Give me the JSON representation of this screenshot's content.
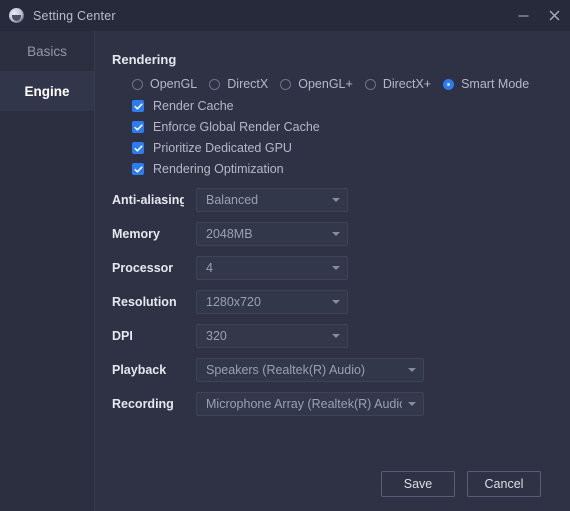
{
  "window": {
    "title": "Setting Center",
    "logo_icon": "app-logo-icon",
    "minimize_label": "–",
    "close_label": "×"
  },
  "sidebar": {
    "items": [
      {
        "label": "Basics",
        "active": false
      },
      {
        "label": "Engine",
        "active": true
      }
    ]
  },
  "main": {
    "section_title": "Rendering",
    "render_modes": [
      {
        "label": "OpenGL",
        "selected": false
      },
      {
        "label": "DirectX",
        "selected": false
      },
      {
        "label": "OpenGL+",
        "selected": false
      },
      {
        "label": "DirectX+",
        "selected": false
      },
      {
        "label": "Smart Mode",
        "selected": true
      }
    ],
    "checkboxes": [
      {
        "label": "Render Cache",
        "checked": true
      },
      {
        "label": "Enforce Global Render Cache",
        "checked": true
      },
      {
        "label": "Prioritize Dedicated GPU",
        "checked": true
      },
      {
        "label": "Rendering Optimization",
        "checked": true
      }
    ],
    "fields": [
      {
        "label": "Anti-aliasing",
        "value": "Balanced",
        "width": "narrow"
      },
      {
        "label": "Memory",
        "value": "2048MB",
        "width": "narrow"
      },
      {
        "label": "Processor",
        "value": "4",
        "width": "narrow"
      },
      {
        "label": "Resolution",
        "value": "1280x720",
        "width": "narrow"
      },
      {
        "label": "DPI",
        "value": "320",
        "width": "narrow"
      },
      {
        "label": "Playback",
        "value": "Speakers (Realtek(R) Audio)",
        "width": "wide"
      },
      {
        "label": "Recording",
        "value": "Microphone Array (Realtek(R) Audio)",
        "width": "wide"
      }
    ],
    "save_label": "Save",
    "cancel_label": "Cancel"
  },
  "colors": {
    "accent": "#2a7cf0",
    "window_bg": "#2e3244",
    "sidebar_bg": "#2b2f40",
    "titlebar_bg": "#262a3a",
    "field_bg": "#32374a"
  }
}
